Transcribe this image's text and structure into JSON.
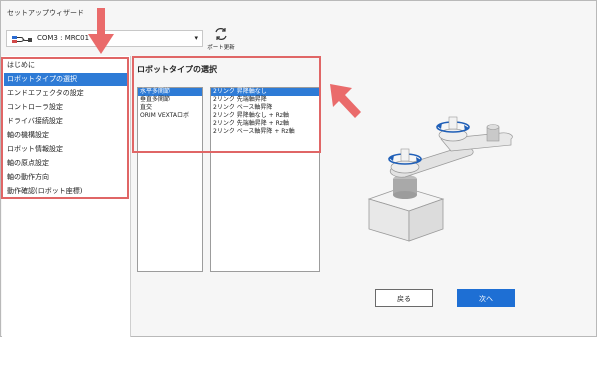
{
  "window": {
    "title": "セットアップウィザード"
  },
  "port": {
    "selected": "COM3 : MRC01",
    "refresh_label": "ポート更新"
  },
  "sidebar": {
    "items": [
      {
        "label": "はじめに"
      },
      {
        "label": "ロボットタイプの選択",
        "selected": true
      },
      {
        "label": "エンドエフェクタの設定"
      },
      {
        "label": "コントローラ設定"
      },
      {
        "label": "ドライバ接続設定"
      },
      {
        "label": "軸の機構設定"
      },
      {
        "label": "ロボット情報設定"
      },
      {
        "label": "軸の原点設定"
      },
      {
        "label": "軸の動作方向"
      },
      {
        "label": "動作確認(ロボット座標)"
      }
    ]
  },
  "main": {
    "title": "ロボットタイプの選択",
    "robot_types": [
      "水平多関節",
      "垂直多関節",
      "直交",
      "ORIM VEXTAロボ"
    ],
    "robot_type_selected": 0,
    "link_types": [
      "2リンク 昇降軸なし",
      "2リンク 先端軸昇降",
      "2リンク ベース軸昇降",
      "2リンク 昇降軸なし + Rz軸",
      "2リンク 先端軸昇降 + Rz軸",
      "2リンク ベース軸昇降 + Rz軸"
    ],
    "link_type_selected": 0
  },
  "buttons": {
    "back": "戻る",
    "next": "次へ"
  },
  "colors": {
    "highlight": "#e06666",
    "accent": "#2e7bd6",
    "next_button": "#1e6fd4"
  }
}
